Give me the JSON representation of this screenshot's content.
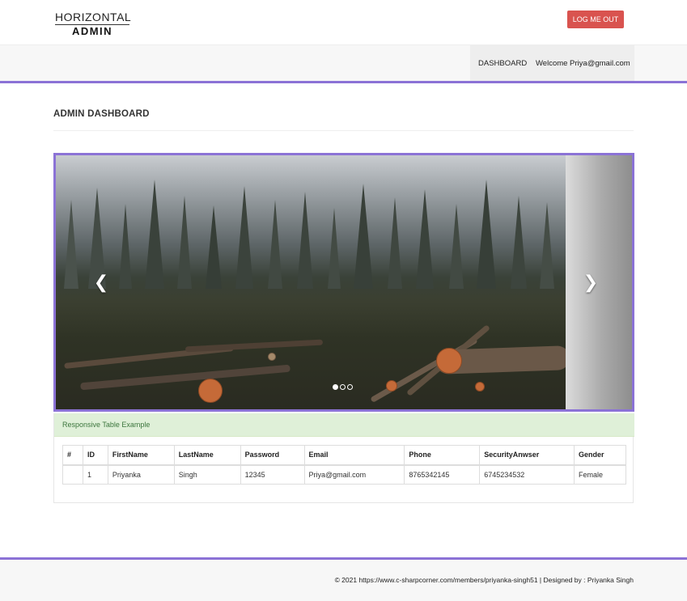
{
  "header": {
    "logo_top": "HORIZONTAL",
    "logo_bottom": "ADMIN",
    "logout_label": "LOG ME OUT"
  },
  "nav": {
    "dashboard": "DASHBOARD",
    "welcome": "Welcome Priya@gmail.com"
  },
  "page": {
    "title": "ADMIN DASHBOARD"
  },
  "carousel": {
    "prev_icon": "chevron-left-icon",
    "next_icon": "chevron-right-icon",
    "slide_count": 3,
    "active_slide": 1
  },
  "panel": {
    "heading": "Responsive Table Example"
  },
  "table": {
    "headers": [
      "#",
      "ID",
      "FirstName",
      "LastName",
      "Password",
      "Email",
      "Phone",
      "SecurityAnwser",
      "Gender"
    ],
    "rows": [
      [
        "",
        "1",
        "Priyanka",
        "Singh",
        "12345",
        "Priya@gmail.com",
        "8765342145",
        "6745234532",
        "Female"
      ]
    ]
  },
  "footer": {
    "text": "© 2021 https://www.c-sharpcorner.com/members/priyanka-singh51 | Designed by : Priyanka Singh"
  },
  "colors": {
    "accent": "#8b72d6",
    "logout": "#d9534f",
    "panel_heading_bg": "#dff0d8",
    "panel_heading_text": "#3c763d"
  }
}
